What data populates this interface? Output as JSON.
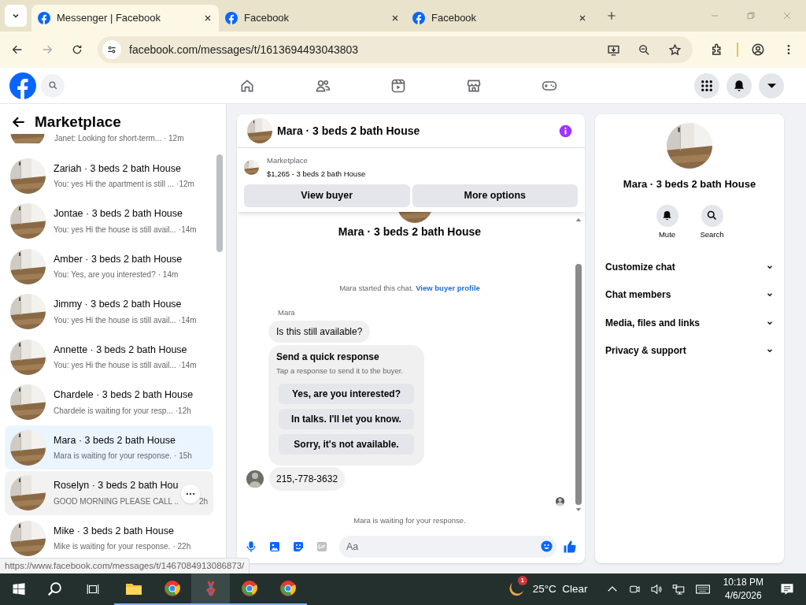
{
  "browser": {
    "tabs": [
      {
        "title": "Messenger | Facebook",
        "selected": true
      },
      {
        "title": "Facebook",
        "selected": false
      },
      {
        "title": "Facebook",
        "selected": false
      }
    ],
    "address": "facebook.com/messages/t/1613694493043803",
    "status_url": "https://www.facebook.com/messages/t/1467084913086873/"
  },
  "sidebar": {
    "title": "Marketplace",
    "partial_preview": "Janet: Looking for short-term... · 12m",
    "conversations": [
      {
        "name": "Zariah · 3 beds 2 bath House",
        "preview": "You: yes Hi the apartment is still ...",
        "time": "·12m",
        "selected": false,
        "hovered": false
      },
      {
        "name": "Jontae · 3 beds 2 bath House",
        "preview": "You: yes Hi the house is still avail...",
        "time": "·14m",
        "selected": false,
        "hovered": false
      },
      {
        "name": "Amber · 3 beds 2 bath House",
        "preview": "You: Yes, are you interested?",
        "time": "· 14m",
        "selected": false,
        "hovered": false
      },
      {
        "name": "Jimmy · 3 beds 2 bath House",
        "preview": "You: yes Hi the house is still avail...",
        "time": "·14m",
        "selected": false,
        "hovered": false
      },
      {
        "name": "Annette · 3 beds 2 bath House",
        "preview": "You: yes Hi the house is still avail...",
        "time": "·14m",
        "selected": false,
        "hovered": false
      },
      {
        "name": "Chardele · 3 beds 2 bath House",
        "preview": "Chardele is waiting for your resp...",
        "time": "·12h",
        "selected": false,
        "hovered": false
      },
      {
        "name": "Mara · 3 beds 2 bath House",
        "preview": "Mara is waiting for your response.",
        "time": "· 15h",
        "selected": true,
        "hovered": false
      },
      {
        "name": "Roselyn · 3 beds 2 bath Hou",
        "preview": "GOOD MORNING PLEASE CALL ..",
        "time": "2h",
        "selected": false,
        "hovered": true
      },
      {
        "name": "Mike · 3 beds 2 bath House",
        "preview": "Mike is waiting for your response.",
        "time": "· 22h",
        "selected": false,
        "hovered": false
      }
    ]
  },
  "chat": {
    "title": "Mara · 3 beds 2 bath House",
    "listing": {
      "source": "Marketplace",
      "summary": "$1,265 - 3 beds 2 bath House",
      "buttons": [
        "View buyer",
        "More options"
      ]
    },
    "intro_name": "Mara · 3 beds 2 bath House",
    "started": "Mara started this chat.",
    "profile_link": "View buyer profile",
    "sender": "Mara",
    "message": "Is this still available?",
    "quick": {
      "title": "Send a quick response",
      "subtitle": "Tap a response to send it to the buyer.",
      "options": [
        "Yes, are you interested?",
        "In talks. I'll let you know.",
        "Sorry, it's not available."
      ]
    },
    "phone_message": "215,-778-3632",
    "waiting": "Mara is waiting for your response.",
    "composer_placeholder": "Aa"
  },
  "details": {
    "name": "Mara · 3 beds 2 bath House",
    "actions": [
      "Mute",
      "Search"
    ],
    "sections": [
      "Customize chat",
      "Chat members",
      "Media, files and links",
      "Privacy & support"
    ]
  },
  "taskbar": {
    "weather_badge": "1",
    "weather": "25°C  Clear",
    "time": "10:18 PM",
    "date": "4/6/2026"
  }
}
